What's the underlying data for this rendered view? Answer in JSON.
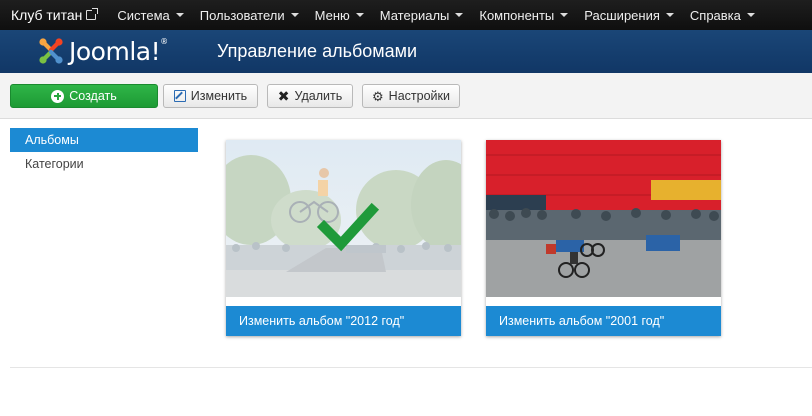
{
  "navbar": {
    "site_name": "Клуб титан",
    "menu": [
      {
        "label": "Система"
      },
      {
        "label": "Пользователи"
      },
      {
        "label": "Меню"
      },
      {
        "label": "Материалы"
      },
      {
        "label": "Компоненты"
      },
      {
        "label": "Расширения"
      },
      {
        "label": "Справка"
      }
    ]
  },
  "header": {
    "logo_text": "Joomla!",
    "logo_mark": "®",
    "title": "Управление альбомами"
  },
  "toolbar": {
    "create_label": "Создать",
    "edit_label": "Изменить",
    "delete_label": "Удалить",
    "options_label": "Настройки"
  },
  "sidebar": {
    "items": [
      {
        "label": "Альбомы",
        "active": true
      },
      {
        "label": "Категории",
        "active": false
      }
    ]
  },
  "albums": [
    {
      "caption": "Изменить альбом \"2012 год\"",
      "selected": true
    },
    {
      "caption": "Изменить альбом \"2001 год\"",
      "selected": false
    }
  ],
  "colors": {
    "navbar_bg": "#141414",
    "header_bg": "#153f70",
    "accent_blue": "#1c8ad3",
    "create_green": "#26a63e",
    "check_green": "#1f9a3a"
  }
}
